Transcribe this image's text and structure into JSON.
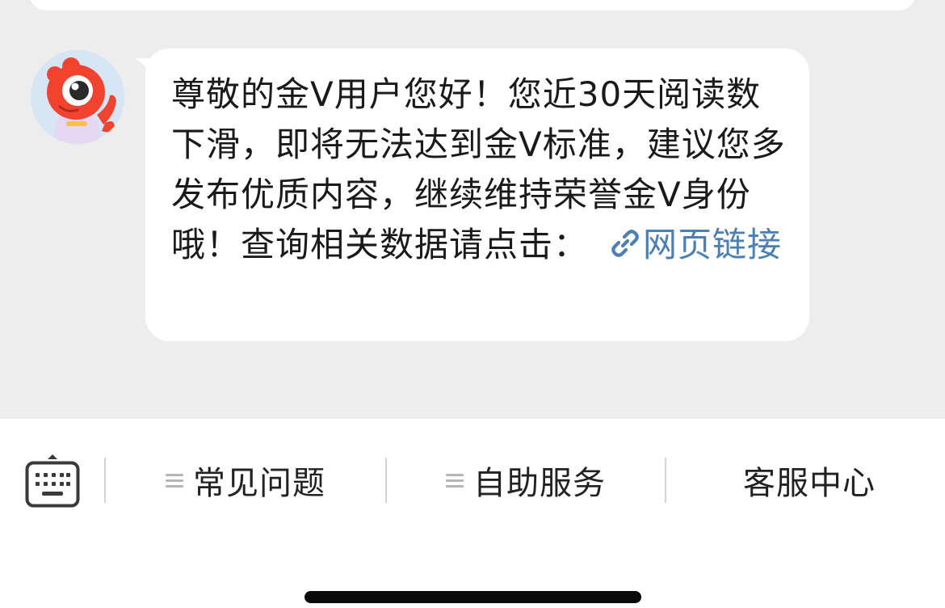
{
  "chat": {
    "message": {
      "text": "尊敬的金V用户您好！您近30天阅读数下滑，即将无法达到金V标准，建议您多发布优质内容，继续维持荣誉金V身份哦！查询相关数据请点击：",
      "link_label": "网页链接"
    }
  },
  "toolbar": {
    "faq_label": "常见问题",
    "self_service_label": "自助服务",
    "support_center_label": "客服中心"
  },
  "colors": {
    "link": "#4c7fb3",
    "background": "#ededed",
    "bubble": "#ffffff",
    "avatar_mascot": "#f2432f"
  }
}
